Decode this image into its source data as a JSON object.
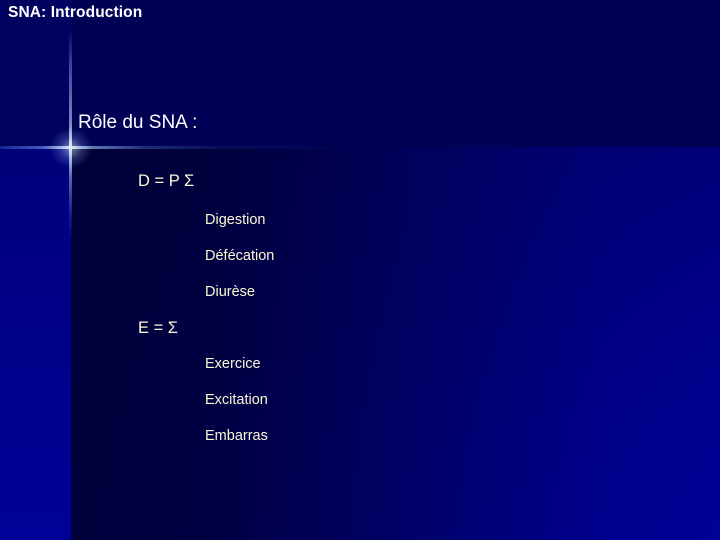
{
  "slide": {
    "title": "SNA: Introduction",
    "heading": "Rôle du SNA :",
    "groups": [
      {
        "formula": "D = P Σ",
        "items": [
          "Digestion",
          "Défécation",
          "Diurèse"
        ]
      },
      {
        "formula": "E = Σ",
        "items": [
          "Exercice",
          "Excitation",
          "Embarras"
        ]
      }
    ]
  },
  "colors": {
    "background_top": "#00005e",
    "background_bottom": "#000190",
    "title_text": "#ffffff",
    "heading_text": "#ffffff",
    "body_text": "#fbf8d4",
    "accent_rule": "#e6f2ff"
  }
}
